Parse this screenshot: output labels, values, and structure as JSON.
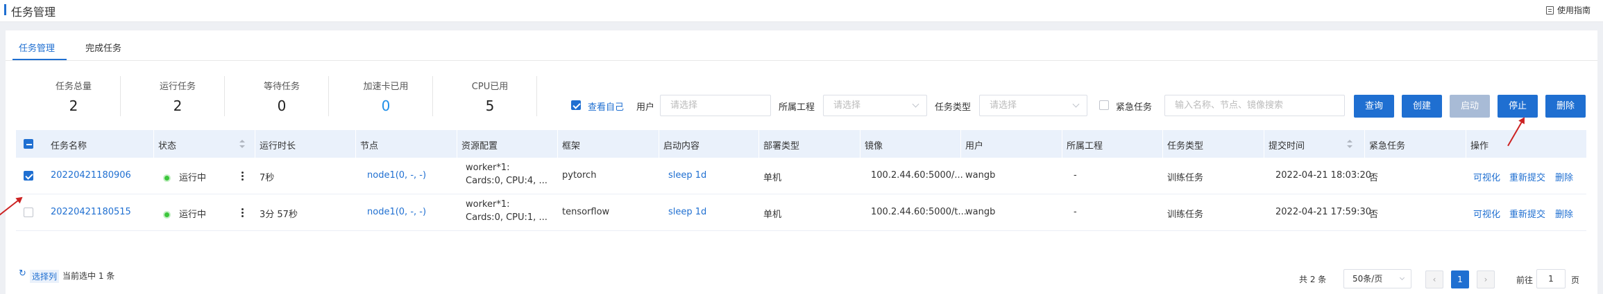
{
  "header": {
    "title": "任务管理",
    "guide_label": "使用指南"
  },
  "tabs": [
    {
      "label": "任务管理",
      "active": true
    },
    {
      "label": "完成任务",
      "active": false
    }
  ],
  "stats": [
    {
      "label": "任务总量",
      "value": "2"
    },
    {
      "label": "运行任务",
      "value": "2"
    },
    {
      "label": "等待任务",
      "value": "0"
    },
    {
      "label": "加速卡已用",
      "value": "0"
    },
    {
      "label": "CPU已用",
      "value": "5"
    }
  ],
  "filters": {
    "view_self_label": "查看自己",
    "view_self_checked": true,
    "user_label": "用户",
    "user_placeholder": "请选择",
    "project_label": "所属工程",
    "project_placeholder": "请选择",
    "task_type_label": "任务类型",
    "task_type_placeholder": "请选择",
    "urgent_label": "紧急任务",
    "urgent_checked": false,
    "search_placeholder": "输入名称、节点、镜像搜索"
  },
  "buttons": {
    "query": "查询",
    "create": "创建",
    "start": "启动",
    "stop": "停止",
    "delete": "删除"
  },
  "table": {
    "headers": [
      "任务名称",
      "状态",
      "运行时长",
      "节点",
      "资源配置",
      "框架",
      "启动内容",
      "部署类型",
      "镜像",
      "用户",
      "所属工程",
      "任务类型",
      "提交时间",
      "紧急任务",
      "操作"
    ],
    "rows": [
      {
        "selected": true,
        "name": "20220421180906",
        "status": "运行中",
        "duration": "7秒",
        "node": "node1(0, -, -)",
        "res_line1": "worker*1:",
        "res_line2": "Cards:0, CPU:4, ...",
        "framework": "pytorch",
        "command": "sleep 1d",
        "deploy": "单机",
        "image": "100.2.44.60:5000/...",
        "user": "wangb",
        "project": "-",
        "task_type": "训练任务",
        "submit_time": "2022-04-21 18:03:20",
        "urgent": "否"
      },
      {
        "selected": false,
        "name": "20220421180515",
        "status": "运行中",
        "duration": "3分 57秒",
        "node": "node1(0, -, -)",
        "res_line1": "worker*1:",
        "res_line2": "Cards:0, CPU:1, ...",
        "framework": "tensorflow",
        "command": "sleep 1d",
        "deploy": "单机",
        "image": "100.2.44.60:5000/t...",
        "user": "wangb",
        "project": "-",
        "task_type": "训练任务",
        "submit_time": "2022-04-21 17:59:30",
        "urgent": "否"
      }
    ],
    "actions": [
      "可视化",
      "重新提交",
      "删除"
    ]
  },
  "footer": {
    "select_col_label": "选择列",
    "selected_text": "当前选中 1 条",
    "total_text": "共 2 条",
    "page_size": "50条/页",
    "current_page": "1",
    "goto_label": "前往",
    "goto_value": "1",
    "page_unit": "页"
  },
  "colors": {
    "primary": "#1f6fd1",
    "running": "#3cc63c",
    "arrow": "#cc2222"
  }
}
